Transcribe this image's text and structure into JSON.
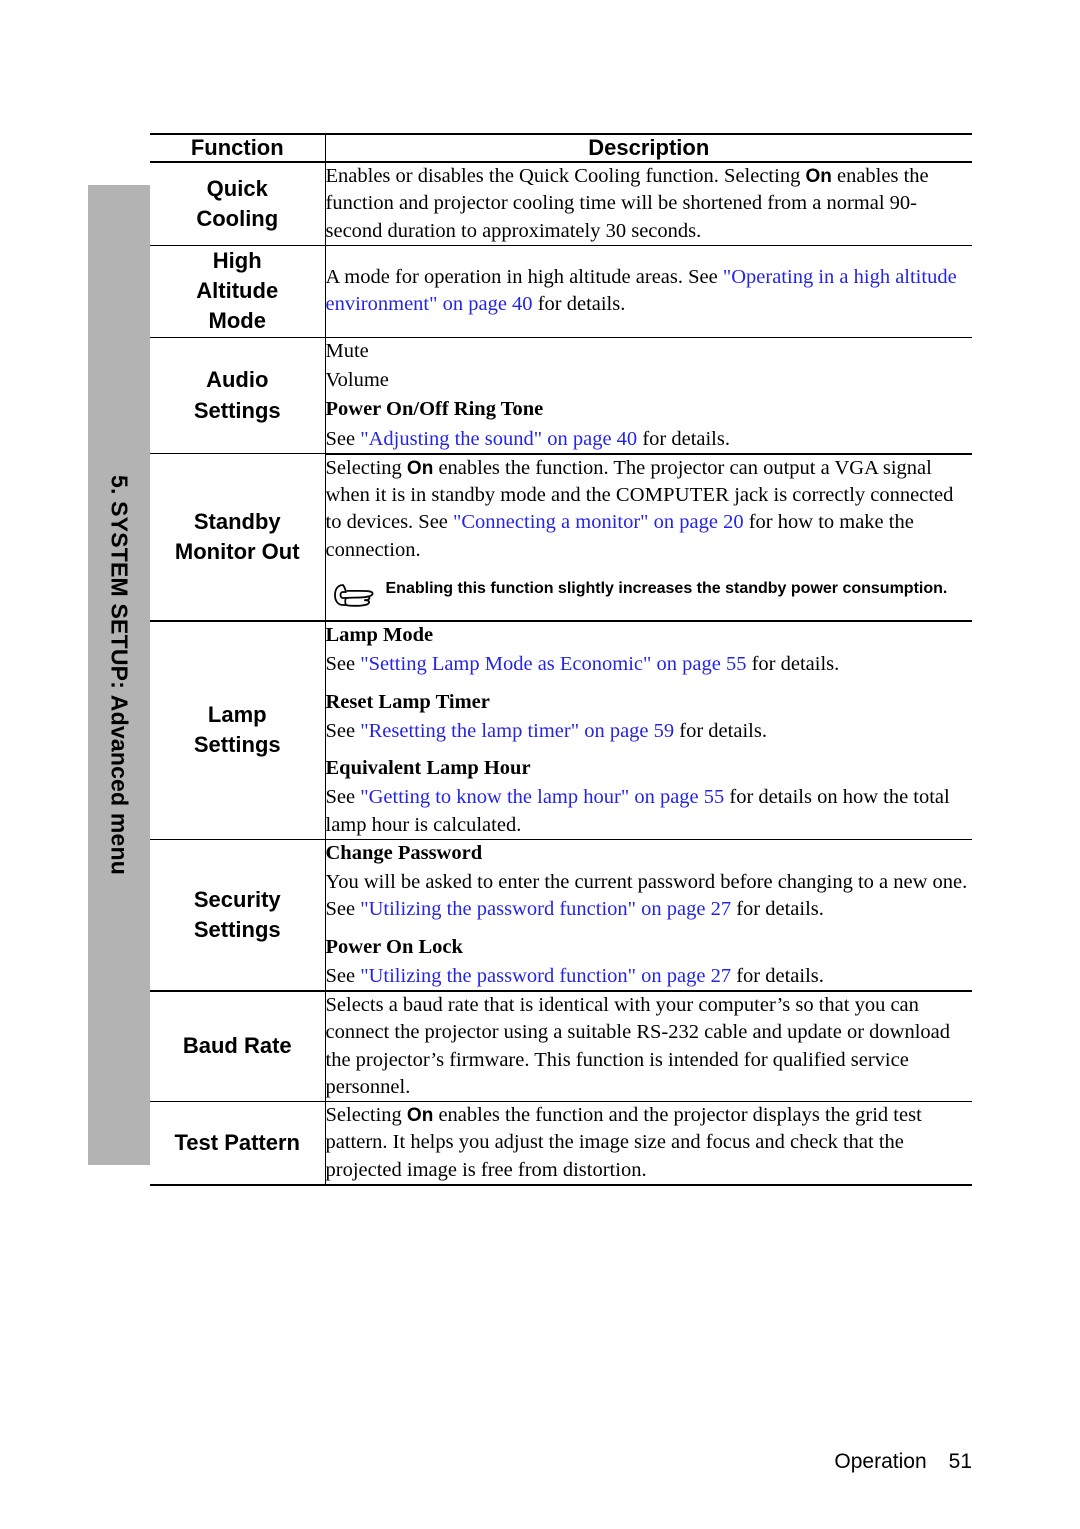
{
  "chapter_tab": {
    "label": "5. SYSTEM SETUP: Advanced menu",
    "background_color": "#b3b3b3"
  },
  "table": {
    "headers": {
      "function": "Function",
      "description": "Description"
    },
    "rows": [
      {
        "function": "Quick\nCooling",
        "function_lines": [
          "Quick",
          "Cooling"
        ],
        "description_blocks": [
          {
            "type": "paragraph",
            "runs": [
              {
                "text": "Enables or disables the Quick Cooling function. Selecting ",
                "style": "normal"
              },
              {
                "text": "On",
                "style": "bold-sans"
              },
              {
                "text": " enables the function and projector cooling time will be shortened from a normal 90-second duration to approximately 30 seconds.",
                "style": "normal"
              }
            ]
          }
        ]
      },
      {
        "function": "High\nAltitude\nMode",
        "function_lines": [
          "High",
          "Altitude",
          "Mode"
        ],
        "description_blocks": [
          {
            "type": "paragraph",
            "runs": [
              {
                "text": "A mode for operation in high altitude areas. See ",
                "style": "normal"
              },
              {
                "text": "\"Operating in a high altitude environment\" on page 40",
                "style": "link"
              },
              {
                "text": " for details.",
                "style": "normal"
              }
            ]
          }
        ]
      },
      {
        "function": "Audio\nSettings",
        "function_lines": [
          "Audio",
          "Settings"
        ],
        "description_blocks": [
          {
            "type": "plain",
            "runs": [
              {
                "text": "Mute",
                "style": "normal"
              }
            ]
          },
          {
            "type": "plain",
            "runs": [
              {
                "text": "Volume",
                "style": "normal"
              }
            ]
          },
          {
            "type": "subhead",
            "runs": [
              {
                "text": "Power On/Off Ring Tone",
                "style": "bold-serif"
              }
            ]
          },
          {
            "type": "paragraph",
            "runs": [
              {
                "text": "See ",
                "style": "normal"
              },
              {
                "text": "\"Adjusting the sound\" on page 40",
                "style": "link"
              },
              {
                "text": " for details.",
                "style": "normal"
              }
            ]
          }
        ]
      },
      {
        "function": "Standby\nMonitor Out",
        "function_lines": [
          "Standby",
          "Monitor Out"
        ],
        "description_blocks": [
          {
            "type": "paragraph",
            "runs": [
              {
                "text": "Selecting ",
                "style": "normal"
              },
              {
                "text": "On",
                "style": "bold-sans"
              },
              {
                "text": " enables the function. The projector can output a VGA signal when it is in standby mode and the ",
                "style": "normal"
              },
              {
                "text": "COMPUTER",
                "style": "smallcaps"
              },
              {
                "text": " jack is correctly connected to devices. See ",
                "style": "normal"
              },
              {
                "text": "\"Connecting a monitor\" on page 20",
                "style": "link"
              },
              {
                "text": " for how to make the connection.",
                "style": "normal"
              }
            ]
          },
          {
            "type": "note",
            "icon": "pointing-hand-icon",
            "runs": [
              {
                "text": "Enabling this function slightly increases the standby power consumption.",
                "style": "bold-sans"
              }
            ]
          }
        ]
      },
      {
        "function": "Lamp\nSettings",
        "function_lines": [
          "Lamp",
          "Settings"
        ],
        "description_blocks": [
          {
            "type": "subhead",
            "runs": [
              {
                "text": "Lamp Mode",
                "style": "bold-serif"
              }
            ]
          },
          {
            "type": "paragraph",
            "runs": [
              {
                "text": "See ",
                "style": "normal"
              },
              {
                "text": "\"Setting Lamp Mode as Economic\" on page 55",
                "style": "link"
              },
              {
                "text": " for details.",
                "style": "normal"
              }
            ]
          },
          {
            "type": "gap"
          },
          {
            "type": "subhead",
            "runs": [
              {
                "text": "Reset Lamp Timer",
                "style": "bold-serif"
              }
            ]
          },
          {
            "type": "paragraph",
            "runs": [
              {
                "text": "See ",
                "style": "normal"
              },
              {
                "text": "\"Resetting the lamp timer\" on page 59",
                "style": "link"
              },
              {
                "text": " for details.",
                "style": "normal"
              }
            ]
          },
          {
            "type": "gap"
          },
          {
            "type": "subhead",
            "runs": [
              {
                "text": "Equivalent Lamp Hour",
                "style": "bold-serif"
              }
            ]
          },
          {
            "type": "paragraph",
            "runs": [
              {
                "text": "See ",
                "style": "normal"
              },
              {
                "text": "\"Getting to know the lamp hour\" on page 55",
                "style": "link"
              },
              {
                "text": " for details on how the total lamp hour is calculated.",
                "style": "normal"
              }
            ]
          }
        ]
      },
      {
        "function": "Security\nSettings",
        "function_lines": [
          "Security",
          "Settings"
        ],
        "description_blocks": [
          {
            "type": "subhead",
            "runs": [
              {
                "text": "Change Password",
                "style": "bold-serif"
              }
            ]
          },
          {
            "type": "paragraph",
            "runs": [
              {
                "text": "You will be asked to enter the current password before changing to a new one. See ",
                "style": "normal"
              },
              {
                "text": "\"Utilizing the password function\" on page 27",
                "style": "link"
              },
              {
                "text": " for details.",
                "style": "normal"
              }
            ]
          },
          {
            "type": "gap"
          },
          {
            "type": "subhead",
            "runs": [
              {
                "text": "Power On Lock",
                "style": "bold-serif"
              }
            ]
          },
          {
            "type": "paragraph",
            "runs": [
              {
                "text": "See ",
                "style": "normal"
              },
              {
                "text": "\"Utilizing the password function\" on page 27",
                "style": "link"
              },
              {
                "text": " for details.",
                "style": "normal"
              }
            ]
          }
        ]
      },
      {
        "function": "Baud Rate",
        "function_lines": [
          "Baud Rate"
        ],
        "description_blocks": [
          {
            "type": "paragraph",
            "runs": [
              {
                "text": "Selects a baud rate that is identical with your computer’s so that you can connect the projector using a suitable RS-232 cable and update or download the projector’s firmware. This function is intended for qualified service personnel.",
                "style": "normal"
              }
            ]
          }
        ]
      },
      {
        "function": "Test Pattern",
        "function_lines": [
          "Test Pattern"
        ],
        "description_blocks": [
          {
            "type": "paragraph",
            "runs": [
              {
                "text": "Selecting ",
                "style": "normal"
              },
              {
                "text": "On",
                "style": "bold-sans"
              },
              {
                "text": " enables the function and the projector displays the grid test pattern. It helps you adjust the image size and focus and check that the projected image is free from distortion.",
                "style": "normal"
              }
            ]
          }
        ]
      }
    ]
  },
  "footer": {
    "section": "Operation",
    "page_number": "51"
  },
  "colors": {
    "link": "#2424e6",
    "tab_gray": "#b3b3b3",
    "text": "#000000"
  }
}
